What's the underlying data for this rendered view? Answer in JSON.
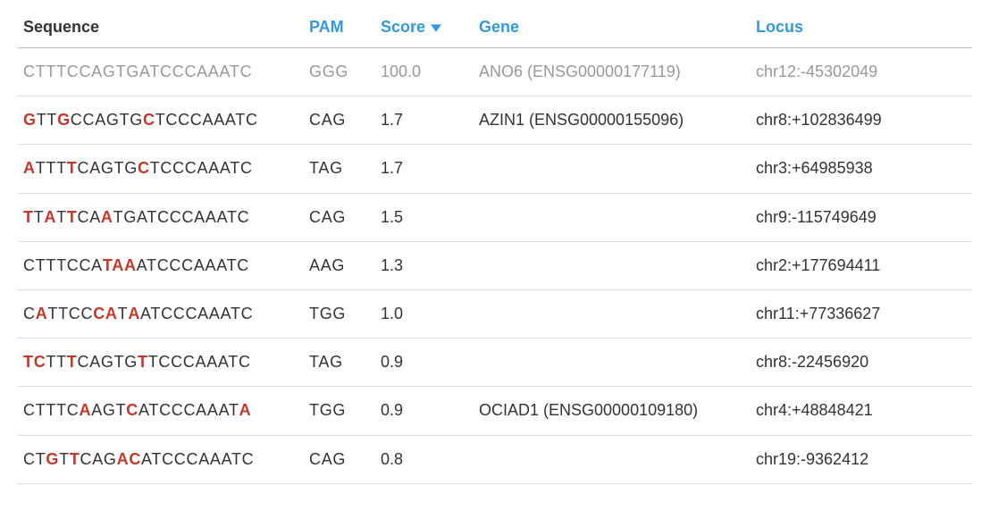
{
  "headers": {
    "sequence": "Sequence",
    "pam": "PAM",
    "score": "Score",
    "gene": "Gene",
    "locus": "Locus"
  },
  "reference_sequence": "CTTTCCAGTGATCCCAAATC",
  "rows": [
    {
      "sequence": [
        {
          "t": "CTTTCCAGTGATCCCAAATC",
          "m": false
        }
      ],
      "pam": "GGG",
      "score": "100.0",
      "gene": "ANO6 (ENSG00000177119)",
      "locus": "chr12:-45302049",
      "reference": true
    },
    {
      "sequence": [
        {
          "t": "G",
          "m": true
        },
        {
          "t": "TT",
          "m": false
        },
        {
          "t": "G",
          "m": true
        },
        {
          "t": "CCAGTG",
          "m": false
        },
        {
          "t": "C",
          "m": true
        },
        {
          "t": "TCCCAAATC",
          "m": false
        }
      ],
      "pam": "CAG",
      "score": "1.7",
      "gene": "AZIN1 (ENSG00000155096)",
      "locus": "chr8:+102836499",
      "reference": false
    },
    {
      "sequence": [
        {
          "t": "A",
          "m": true
        },
        {
          "t": "TTT",
          "m": false
        },
        {
          "t": "T",
          "m": true
        },
        {
          "t": "CAGTG",
          "m": false
        },
        {
          "t": "C",
          "m": true
        },
        {
          "t": "TCCCAAATC",
          "m": false
        }
      ],
      "pam": "TAG",
      "score": "1.7",
      "gene": "",
      "locus": "chr3:+64985938",
      "reference": false
    },
    {
      "sequence": [
        {
          "t": "T",
          "m": true
        },
        {
          "t": "T",
          "m": false
        },
        {
          "t": "A",
          "m": true
        },
        {
          "t": "T",
          "m": false
        },
        {
          "t": "T",
          "m": true
        },
        {
          "t": "CA",
          "m": false
        },
        {
          "t": "A",
          "m": true
        },
        {
          "t": "TGATCCCAAATC",
          "m": false
        }
      ],
      "pam": "CAG",
      "score": "1.5",
      "gene": "",
      "locus": "chr9:-115749649",
      "reference": false
    },
    {
      "sequence": [
        {
          "t": "CTTTCCA",
          "m": false
        },
        {
          "t": "TAA",
          "m": true
        },
        {
          "t": "ATCCCAAATC",
          "m": false
        }
      ],
      "pam": "AAG",
      "score": "1.3",
      "gene": "",
      "locus": "chr2:+177694411",
      "reference": false
    },
    {
      "sequence": [
        {
          "t": "C",
          "m": false
        },
        {
          "t": "A",
          "m": true
        },
        {
          "t": "TTCC",
          "m": false
        },
        {
          "t": "CA",
          "m": true
        },
        {
          "t": "T",
          "m": false
        },
        {
          "t": "A",
          "m": true
        },
        {
          "t": "ATCCCAAATC",
          "m": false
        }
      ],
      "pam": "TGG",
      "score": "1.0",
      "gene": "",
      "locus": "chr11:+77336627",
      "reference": false
    },
    {
      "sequence": [
        {
          "t": "TC",
          "m": true
        },
        {
          "t": "TT",
          "m": false
        },
        {
          "t": "T",
          "m": true
        },
        {
          "t": "CAGTG",
          "m": false
        },
        {
          "t": "T",
          "m": true
        },
        {
          "t": "TCCCAAATC",
          "m": false
        }
      ],
      "pam": "TAG",
      "score": "0.9",
      "gene": "",
      "locus": "chr8:-22456920",
      "reference": false
    },
    {
      "sequence": [
        {
          "t": "CTTTC",
          "m": false
        },
        {
          "t": "A",
          "m": true
        },
        {
          "t": "AGT",
          "m": false
        },
        {
          "t": "C",
          "m": true
        },
        {
          "t": "ATCCCAAAT",
          "m": false
        },
        {
          "t": "A",
          "m": true
        }
      ],
      "pam": "TGG",
      "score": "0.9",
      "gene": "OCIAD1 (ENSG00000109180)",
      "locus": "chr4:+48848421",
      "reference": false
    },
    {
      "sequence": [
        {
          "t": "CT",
          "m": false
        },
        {
          "t": "G",
          "m": true
        },
        {
          "t": "T",
          "m": false
        },
        {
          "t": "T",
          "m": true
        },
        {
          "t": "CAG",
          "m": false
        },
        {
          "t": "AC",
          "m": true
        },
        {
          "t": "ATCCCAAATC",
          "m": false
        }
      ],
      "pam": "CAG",
      "score": "0.8",
      "gene": "",
      "locus": "chr19:-9362412",
      "reference": false
    }
  ]
}
